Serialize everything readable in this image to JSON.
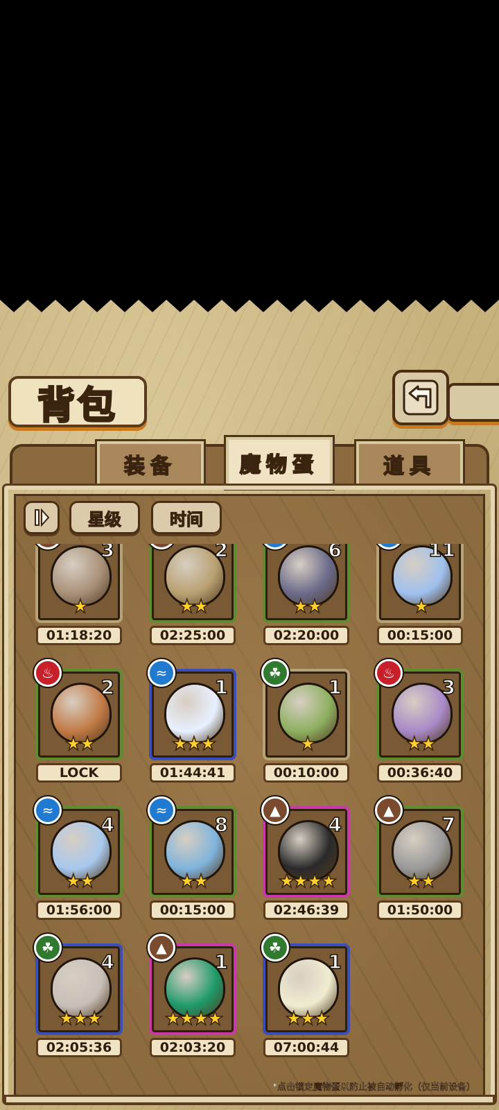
{
  "header": {
    "title": "背包"
  },
  "tabs": [
    {
      "label": "装备",
      "active": false
    },
    {
      "label": "魔物蛋",
      "active": true
    },
    {
      "label": "道具",
      "active": false
    }
  ],
  "sort": {
    "toggle_icon": "order-toggle-icon",
    "by_stars": "星级",
    "by_time": "时间"
  },
  "eggs": [
    {
      "count": "3",
      "stars": "★",
      "time": "01:18:20",
      "element": "earth",
      "rarity": "tan",
      "color": "#a89078"
    },
    {
      "count": "2",
      "stars": "★★",
      "time": "02:25:00",
      "element": "earth",
      "rarity": "green",
      "color": "#b8a070"
    },
    {
      "count": "6",
      "stars": "★★",
      "time": "02:20:00",
      "element": "water",
      "rarity": "green",
      "color": "#6a6a8a"
    },
    {
      "count": "11",
      "stars": "★",
      "time": "00:15:00",
      "element": "water",
      "rarity": "tan",
      "color": "#9fc0ee"
    },
    {
      "count": "2",
      "stars": "★★",
      "time": "LOCK",
      "element": "fire",
      "rarity": "green",
      "color": "#c27a45"
    },
    {
      "count": "1",
      "stars": "★★★",
      "time": "01:44:41",
      "element": "water",
      "rarity": "blue",
      "color": "#e8f0ff"
    },
    {
      "count": "1",
      "stars": "★",
      "time": "00:10:00",
      "element": "grass",
      "rarity": "tan",
      "color": "#8fb060"
    },
    {
      "count": "3",
      "stars": "★★",
      "time": "00:36:40",
      "element": "fire",
      "rarity": "green",
      "color": "#a98ac8"
    },
    {
      "count": "4",
      "stars": "★★",
      "time": "01:56:00",
      "element": "water",
      "rarity": "green",
      "color": "#a8c8ee"
    },
    {
      "count": "8",
      "stars": "★★",
      "time": "00:15:00",
      "element": "water",
      "rarity": "green",
      "color": "#7fb4dc"
    },
    {
      "count": "4",
      "stars": "★★★★",
      "time": "02:46:39",
      "element": "earth",
      "rarity": "pink",
      "color": "#2a2a2a"
    },
    {
      "count": "7",
      "stars": "★★",
      "time": "01:50:00",
      "element": "earth",
      "rarity": "green",
      "color": "#9a9a9a"
    },
    {
      "count": "4",
      "stars": "★★★",
      "time": "02:05:36",
      "element": "grass",
      "rarity": "blue",
      "color": "#c8c0b8"
    },
    {
      "count": "1",
      "stars": "★★★★",
      "time": "02:03:20",
      "element": "earth",
      "rarity": "pink",
      "color": "#1e9a6a"
    },
    {
      "count": "1",
      "stars": "★★★",
      "time": "07:00:44",
      "element": "grass",
      "rarity": "blue",
      "color": "#f0ecd0"
    }
  ],
  "footnote": "*点击锁定魔物蛋以防止被自动孵化（仅当前设备）"
}
